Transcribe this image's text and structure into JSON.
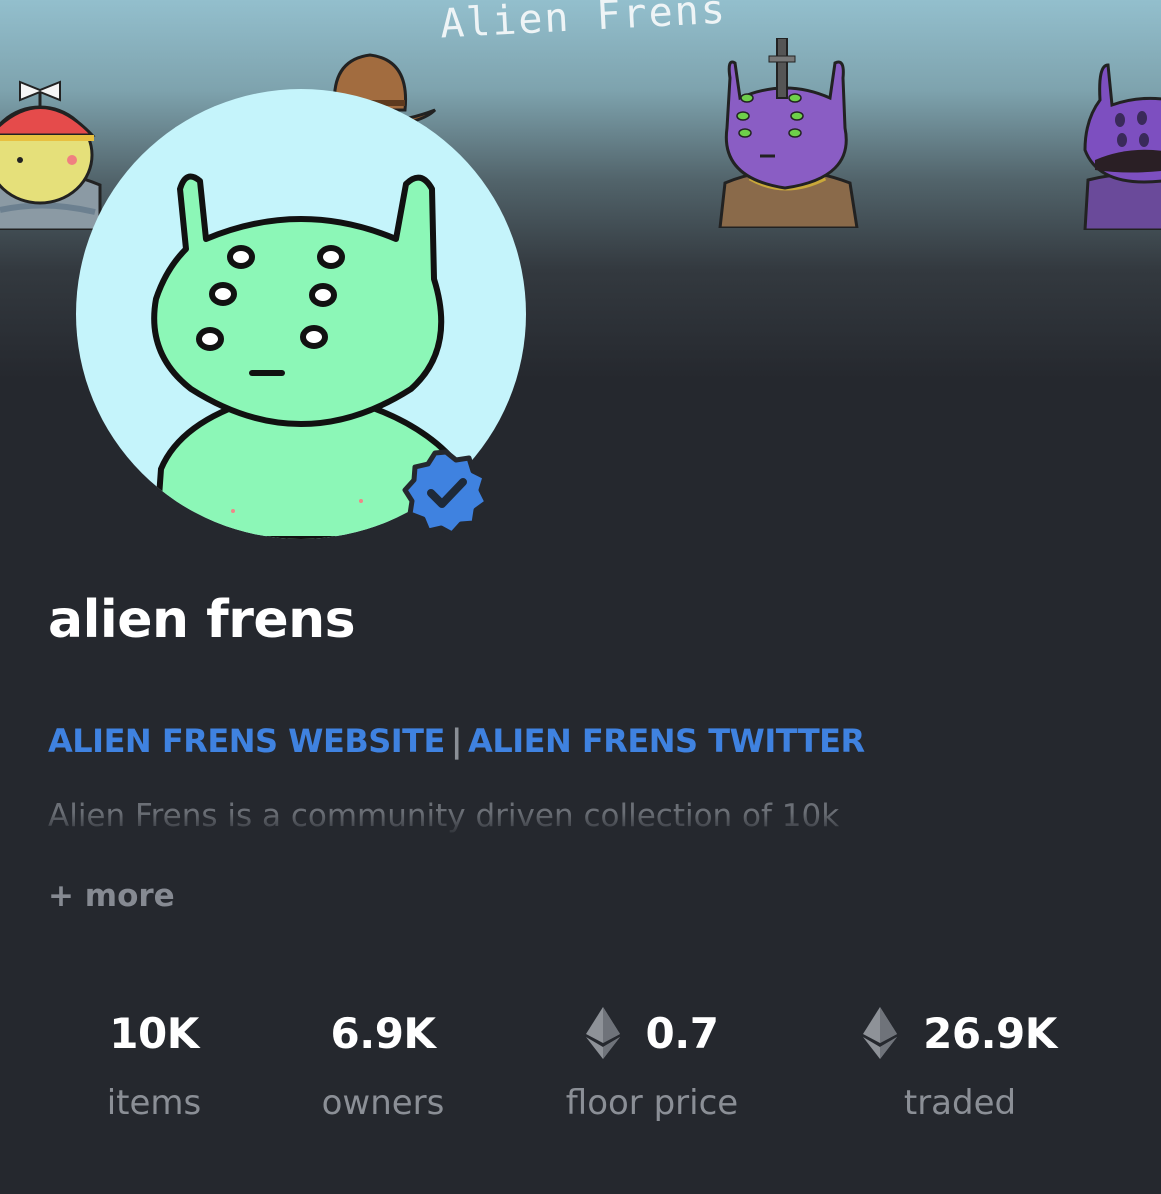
{
  "banner": {
    "title": "Alien Frens"
  },
  "collection": {
    "name": "alien frens",
    "links": {
      "website": "ALIEN FRENS WEBSITE",
      "separator": "|",
      "twitter": "ALIEN FRENS TWITTER"
    },
    "description": "Alien Frens is a community driven collection of 10k",
    "more_label": "+ more",
    "verified": true
  },
  "stats": {
    "items": {
      "value": "10K",
      "label": "items"
    },
    "owners": {
      "value": "6.9K",
      "label": "owners"
    },
    "floor_price": {
      "value": "0.7",
      "label": "floor price",
      "currency_icon": "ethereum-icon"
    },
    "traded": {
      "value": "26.9K",
      "label": "traded",
      "currency_icon": "ethereum-icon"
    }
  },
  "colors": {
    "background": "#25282e",
    "link": "#3f82e0",
    "verified_badge": "#3f82e0",
    "avatar_bg": "#c5f4fb",
    "alien_green": "#8cf7b7"
  }
}
